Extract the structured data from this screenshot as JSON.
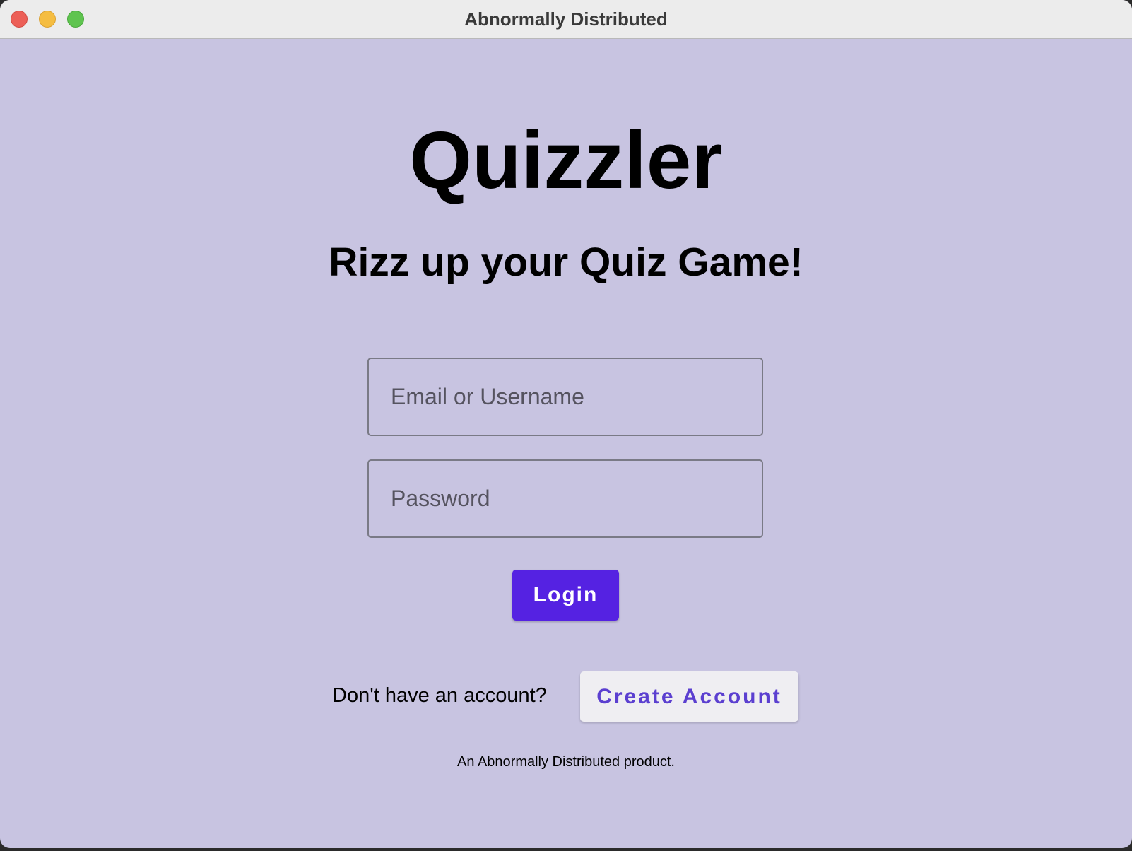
{
  "window": {
    "title": "Abnormally Distributed"
  },
  "app": {
    "title": "Quizzler",
    "tagline": "Rizz up your Quiz Game!"
  },
  "form": {
    "email_placeholder": "Email or Username",
    "password_placeholder": "Password",
    "login_label": "Login"
  },
  "signup": {
    "prompt": "Don't have an account?",
    "button_label": "Create Account"
  },
  "footer": {
    "text": "An Abnormally Distributed product."
  },
  "colors": {
    "background": "#c8c4e1",
    "login_button": "#5522e2",
    "create_account_text": "#5b3fd0"
  }
}
